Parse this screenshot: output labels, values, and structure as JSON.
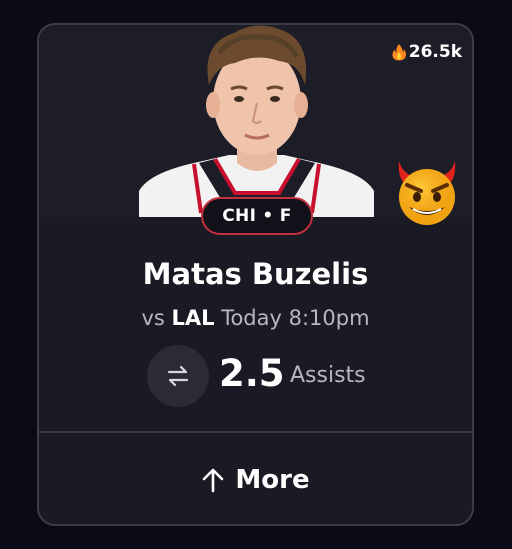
{
  "card": {
    "heat_count": "26.5k",
    "team_position": "CHI • F",
    "player_name": "Matas Buzelis",
    "game": {
      "vs_prefix": "vs",
      "opponent": "LAL",
      "time": "Today 8:10pm"
    },
    "line_value": "2.5",
    "stat_type": "Assists",
    "more_label": "More"
  },
  "icons": {
    "heat": "flame-icon",
    "badge": "devil-emoji-icon",
    "swap": "swap-arrows-icon",
    "more": "arrow-up-icon"
  },
  "colors": {
    "background": "#0b0b16",
    "card": "#1a1a25",
    "team_badge_border": "#c0303f",
    "text_secondary": "#b7b7c2"
  }
}
